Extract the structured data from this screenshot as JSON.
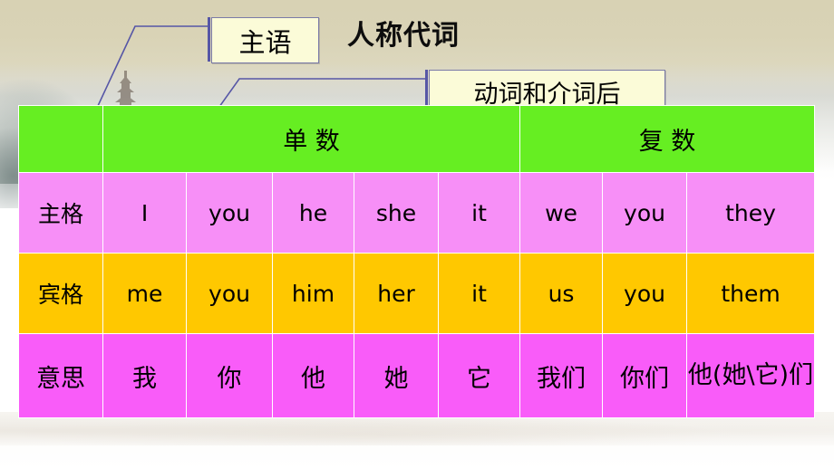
{
  "slide": {
    "title": "人称代词",
    "background": {
      "scene": "faded ink-wash landscape with pagoda",
      "gradient_top": "#d8d2b4",
      "gradient_bottom": "#ffffff"
    }
  },
  "callouts": [
    {
      "id": "subject",
      "label": "主语",
      "fill": "#fbfbd8",
      "border": "#7a7aa8",
      "accent": "#5656a6"
    },
    {
      "id": "object",
      "label": "动词和介词后",
      "fill": "#fbfbd8",
      "border": "#7a7aa8",
      "accent": "#5656a6"
    }
  ],
  "table": {
    "colors": {
      "header": "#66ee22",
      "row_subject": "#f78ff7",
      "row_object": "#ffc800",
      "row_meaning": "#f95cf9",
      "gridline": "#ffffff"
    },
    "header": {
      "corner": "",
      "singular": "单 数",
      "plural": "复 数"
    },
    "rows": [
      {
        "label": "主格",
        "cells": [
          "I",
          "you",
          "he",
          "she",
          "it",
          "we",
          "you",
          "they"
        ]
      },
      {
        "label": "宾格",
        "cells": [
          "me",
          "you",
          "him",
          "her",
          "it",
          "us",
          "you",
          "them"
        ]
      },
      {
        "label": "意思",
        "cells": [
          "我",
          "你",
          "他",
          "她",
          "它",
          "我们",
          "你们",
          "他(她\\它)们"
        ]
      }
    ]
  }
}
